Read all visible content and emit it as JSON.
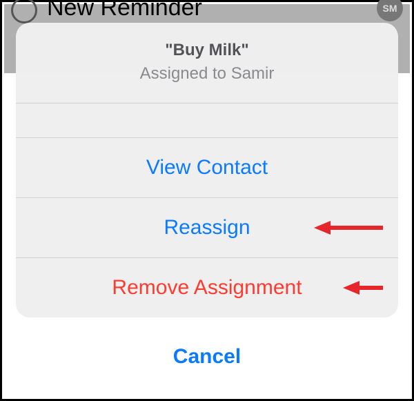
{
  "background": {
    "reminder_title": "New Reminder",
    "avatar_initials": "SM"
  },
  "sheet": {
    "title": "\"Buy Milk\"",
    "subtitle": "Assigned to Samir",
    "actions": {
      "view_contact": "View Contact",
      "reassign": "Reassign",
      "remove": "Remove Assignment"
    },
    "cancel": "Cancel"
  }
}
